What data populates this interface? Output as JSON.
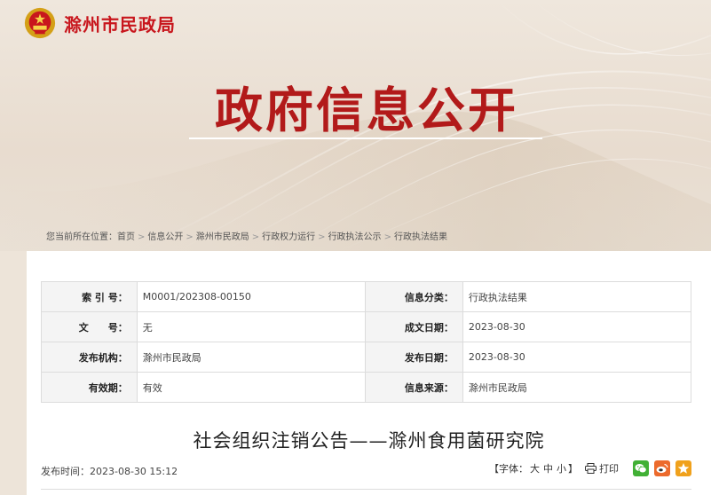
{
  "header": {
    "site_name": "滁州市民政局",
    "banner_title": "政府信息公开"
  },
  "breadcrumb": {
    "prefix": "您当前所在位置：",
    "items": [
      "首页",
      "信息公开",
      "滁州市民政局",
      "行政权力运行",
      "行政执法公示",
      "行政执法结果"
    ],
    "separator": ">"
  },
  "meta": {
    "index_label": "索 引 号：",
    "index_value": "M0001/202308-00150",
    "category_label": "信息分类：",
    "category_value": "行政执法结果",
    "doc_no_label": "文　　号：",
    "doc_no_value": "无",
    "created_label": "成文日期：",
    "created_value": "2023-08-30",
    "org_label": "发布机构：",
    "org_value": "滁州市民政局",
    "published_label": "发布日期：",
    "published_value": "2023-08-30",
    "validity_label": "有效期：",
    "validity_value": "有效",
    "source_label": "信息来源：",
    "source_value": "滁州市民政局"
  },
  "article": {
    "title": "社会组织注销公告——滁州食用菌研究院",
    "pub_time": "发布时间：2023-08-30 15:12"
  },
  "tools": {
    "font_prefix": "【字体：",
    "font_large": "大",
    "font_medium": "中",
    "font_small": "小",
    "font_suffix": "】",
    "print_label": "打印"
  },
  "colors": {
    "brand_red": "#c8161d",
    "title_red": "#b21a1a"
  },
  "icons": {
    "emblem": "national-emblem-icon",
    "print": "printer-icon",
    "wechat": "wechat-icon",
    "weibo": "weibo-icon",
    "qzone": "qzone-star-icon"
  }
}
